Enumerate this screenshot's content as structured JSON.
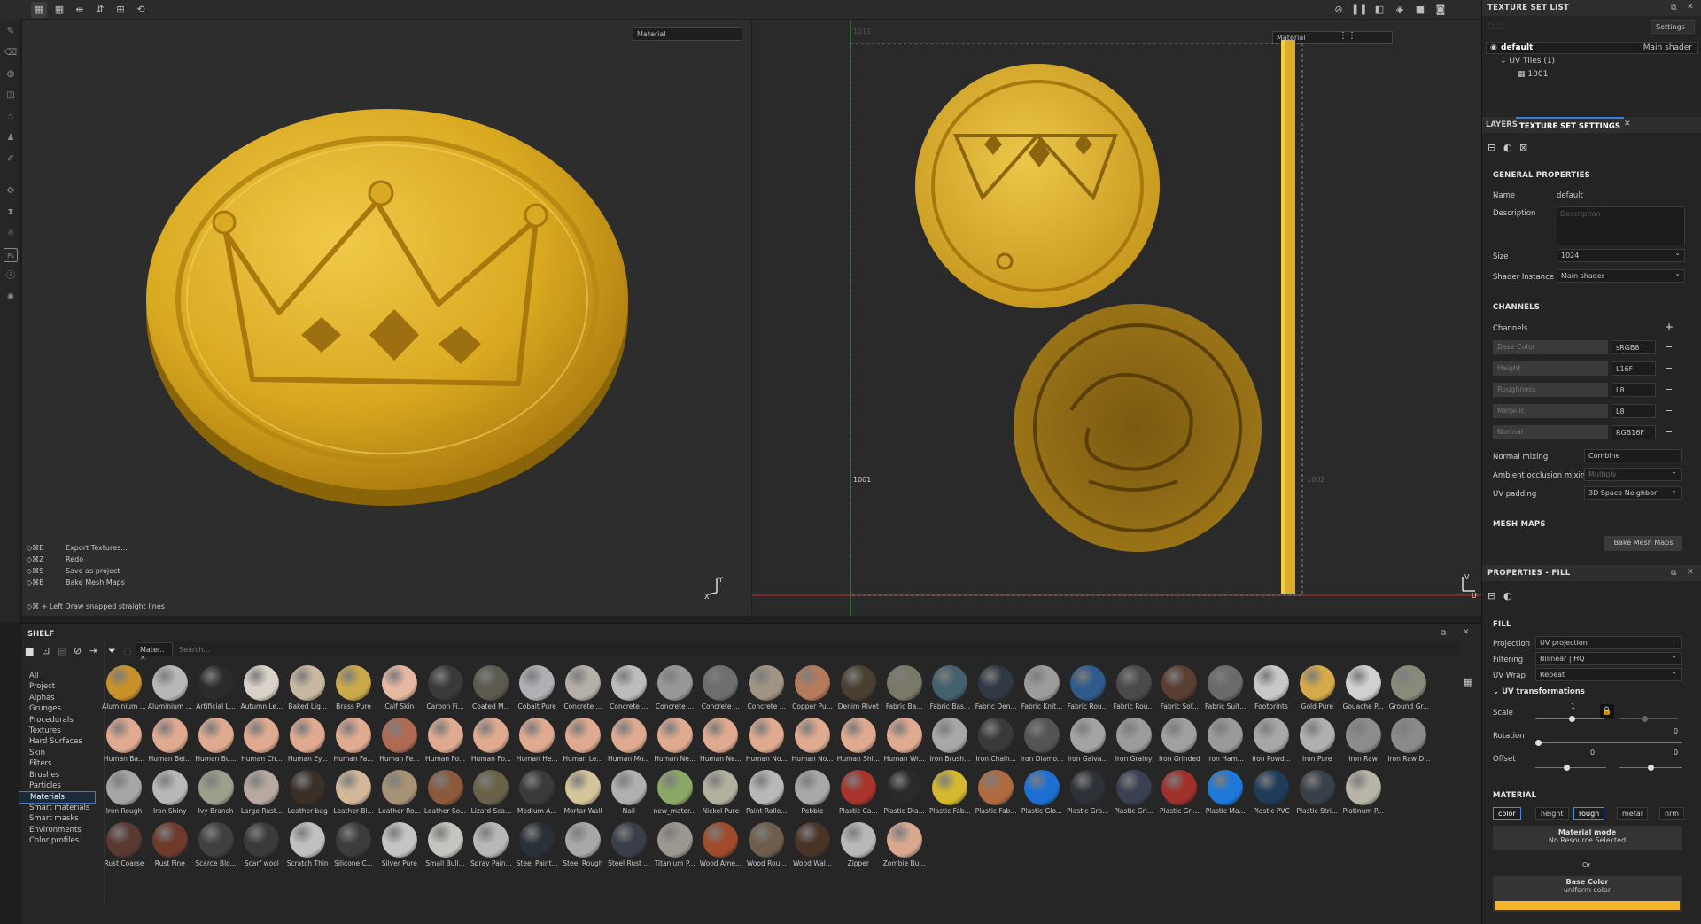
{
  "toolbar": {
    "viewport_left_select": "Material",
    "viewport_right_select": "Material"
  },
  "hotkeys": [
    {
      "keys": "◇⌘E",
      "action": "Export Textures..."
    },
    {
      "keys": "◇⌘Z",
      "action": "Redo"
    },
    {
      "keys": "◇⌘S",
      "action": "Save as project"
    },
    {
      "keys": "◇⌘B",
      "action": "Bake Mesh Maps"
    }
  ],
  "hint": "◇⌘ + Left  Draw snapped straight lines",
  "uv": {
    "tile_label": "1001",
    "next_tile_label": "1002",
    "top_tile_label": "1011"
  },
  "texture_set_list": {
    "title": "TEXTURE SET LIST",
    "settings_button": "Settings",
    "set_name": "default",
    "set_shader": "Main shader",
    "uv_tiles_label": "UV Tiles (1)",
    "tile": "1001"
  },
  "tabs": {
    "layers": "LAYERS",
    "texture_set_settings": "TEXTURE SET SETTINGS"
  },
  "general": {
    "title": "GENERAL PROPERTIES",
    "name_label": "Name",
    "name_value": "default",
    "description_label": "Description",
    "description_placeholder": "Description",
    "size_label": "Size",
    "size_value": "1024",
    "shader_label": "Shader Instance",
    "shader_value": "Main shader"
  },
  "channels": {
    "title": "CHANNELS",
    "channels_label": "Channels",
    "items": [
      {
        "name": "Base Color",
        "format": "sRGB8"
      },
      {
        "name": "Height",
        "format": "L16F"
      },
      {
        "name": "Roughness",
        "format": "L8"
      },
      {
        "name": "Metallic",
        "format": "L8"
      },
      {
        "name": "Normal",
        "format": "RGB16F"
      }
    ],
    "normal_mixing_label": "Normal mixing",
    "normal_mixing_value": "Combine",
    "ao_mixing_label": "Ambient occlusion mixing",
    "ao_mixing_value": "Multiply",
    "uv_padding_label": "UV padding",
    "uv_padding_value": "3D Space Neighbor"
  },
  "mesh_maps": {
    "title": "MESH MAPS",
    "bake_button": "Bake Mesh Maps"
  },
  "properties": {
    "title": "PROPERTIES - FILL",
    "fill_title": "FILL",
    "projection_label": "Projection",
    "projection_value": "UV projection",
    "filtering_label": "Filtering",
    "filtering_value": "Bilinear | HQ",
    "uvwrap_label": "UV Wrap",
    "uvwrap_value": "Repeat",
    "uvtrans_title": "UV transformations",
    "scale_label": "Scale",
    "scale_value": "1",
    "rotation_label": "Rotation",
    "rotation_value": "0",
    "offset_label": "Offset",
    "offset_x": "0",
    "offset_y": "0",
    "material_title": "MATERIAL",
    "mat_tabs": [
      "color",
      "height",
      "rough",
      "metal",
      "nrm"
    ],
    "material_mode_label": "Material mode",
    "material_mode_value": "No Resource Selected",
    "or_label": "Or",
    "base_color_label": "Base Color",
    "base_color_value": "uniform color",
    "base_color_hex": "#f4b62a"
  },
  "shelf": {
    "title": "SHELF",
    "filter_chip": "Mater..",
    "search_placeholder": "Search...",
    "categories": [
      "All",
      "Project",
      "Alphas",
      "Grunges",
      "Procedurals",
      "Textures",
      "Hard Surfaces",
      "Skin",
      "Filters",
      "Brushes",
      "Particles",
      "Materials",
      "Smart materials",
      "Smart masks",
      "Environments",
      "Color profiles"
    ],
    "selected_category": "Materials",
    "materials": [
      {
        "name": "Aluminium ...",
        "color": "#c9912a"
      },
      {
        "name": "Aluminium ...",
        "color": "#b8b8b8"
      },
      {
        "name": "Artificial L...",
        "color": "#2c2c2c"
      },
      {
        "name": "Autumn Le...",
        "color": "#d9d2c8"
      },
      {
        "name": "Baked Lig...",
        "color": "#c8b8a0"
      },
      {
        "name": "Brass Pure",
        "color": "#c9a94a"
      },
      {
        "name": "Calf Skin",
        "color": "#e6b8a2"
      },
      {
        "name": "Carbon Fi...",
        "color": "#3a3a3a"
      },
      {
        "name": "Coated M...",
        "color": "#5c5a4e"
      },
      {
        "name": "Cobalt Pure",
        "color": "#b0b0b4"
      },
      {
        "name": "Concrete ...",
        "color": "#b4b0a8"
      },
      {
        "name": "Concrete ...",
        "color": "#bcbcbc"
      },
      {
        "name": "Concrete ...",
        "color": "#989898"
      },
      {
        "name": "Concrete ...",
        "color": "#6e6e6e"
      },
      {
        "name": "Concrete ...",
        "color": "#a09484"
      },
      {
        "name": "Copper Pu...",
        "color": "#b57a5c"
      },
      {
        "name": "Denim Rivet",
        "color": "#4a4032"
      },
      {
        "name": "Fabric Ba...",
        "color": "#7a7866"
      },
      {
        "name": "Fabric Bas...",
        "color": "#44606e"
      },
      {
        "name": "Fabric Den...",
        "color": "#303844"
      },
      {
        "name": "Fabric Knit...",
        "color": "#9c9c9c"
      },
      {
        "name": "Fabric Rou...",
        "color": "#2e5a8c"
      },
      {
        "name": "Fabric Rou...",
        "color": "#4a4a4a"
      },
      {
        "name": "Fabric Sof...",
        "color": "#5a3e30"
      },
      {
        "name": "Fabric Suit...",
        "color": "#6a6a6a"
      },
      {
        "name": "Footprints",
        "color": "#c8c8c8"
      },
      {
        "name": "Gold Pure",
        "color": "#d4aa4a"
      },
      {
        "name": "Gouache P...",
        "color": "#d0d0d0"
      },
      {
        "name": "Ground Gr...",
        "color": "#8a8a7a"
      },
      {
        "name": "Human Ba...",
        "color": "#e0aa90"
      },
      {
        "name": "Human Bel...",
        "color": "#e0aa90"
      },
      {
        "name": "Human Bu...",
        "color": "#e0aa90"
      },
      {
        "name": "Human Ch...",
        "color": "#e0aa90"
      },
      {
        "name": "Human Ey...",
        "color": "#e0aa90"
      },
      {
        "name": "Human Fa...",
        "color": "#e0aa90"
      },
      {
        "name": "Human Fe...",
        "color": "#b06a54"
      },
      {
        "name": "Human Fo...",
        "color": "#e0aa90"
      },
      {
        "name": "Human Fo...",
        "color": "#e0aa90"
      },
      {
        "name": "Human He...",
        "color": "#e0aa90"
      },
      {
        "name": "Human Le...",
        "color": "#e0aa90"
      },
      {
        "name": "Human Mo...",
        "color": "#e0aa90"
      },
      {
        "name": "Human Ne...",
        "color": "#e0aa90"
      },
      {
        "name": "Human Ne...",
        "color": "#e0aa90"
      },
      {
        "name": "Human No...",
        "color": "#e0aa90"
      },
      {
        "name": "Human No...",
        "color": "#e0aa90"
      },
      {
        "name": "Human Shi...",
        "color": "#e0aa90"
      },
      {
        "name": "Human Wr...",
        "color": "#e0aa90"
      },
      {
        "name": "Iron Brush...",
        "color": "#a8a8a8"
      },
      {
        "name": "Iron Chain...",
        "color": "#3a3a3a"
      },
      {
        "name": "Iron Diamo...",
        "color": "#545454"
      },
      {
        "name": "Iron Galva...",
        "color": "#a4a4a4"
      },
      {
        "name": "Iron Grainy",
        "color": "#9c9c9c"
      },
      {
        "name": "Iron Grinded",
        "color": "#a0a0a0"
      },
      {
        "name": "Iron Ham...",
        "color": "#9a9a9a"
      },
      {
        "name": "Iron Powd...",
        "color": "#a8a8a8"
      },
      {
        "name": "Iron Pure",
        "color": "#b0b0b0"
      },
      {
        "name": "Iron Raw",
        "color": "#8c8c8c"
      },
      {
        "name": "Iron Raw D...",
        "color": "#8a8a8a"
      },
      {
        "name": "Iron Rough",
        "color": "#a6a6a6"
      },
      {
        "name": "Iron Shiny",
        "color": "#b8b8b8"
      },
      {
        "name": "Ivy Branch",
        "color": "#9aa08a"
      },
      {
        "name": "Large Rust...",
        "color": "#b8a8a0"
      },
      {
        "name": "Leather bag",
        "color": "#3a3028"
      },
      {
        "name": "Leather Bl...",
        "color": "#d2b898"
      },
      {
        "name": "Leather Ro...",
        "color": "#a89276"
      },
      {
        "name": "Leather So...",
        "color": "#8a5a3a"
      },
      {
        "name": "Lizard Sca...",
        "color": "#6a6248"
      },
      {
        "name": "Medium A...",
        "color": "#3a3a3a"
      },
      {
        "name": "Mortar Wall",
        "color": "#d4c49a"
      },
      {
        "name": "Nail",
        "color": "#b0b0b0"
      },
      {
        "name": "new_mater...",
        "color": "#8ca868"
      },
      {
        "name": "Nickel Pure",
        "color": "#b4b0a0"
      },
      {
        "name": "Paint Rolle...",
        "color": "#b8b8b8"
      },
      {
        "name": "Pebble",
        "color": "#a8a8a8"
      },
      {
        "name": "Plastic Ca...",
        "color": "#a8342c"
      },
      {
        "name": "Plastic Dia...",
        "color": "#2a2a2a"
      },
      {
        "name": "Plastic Fab...",
        "color": "#d4b830"
      },
      {
        "name": "Plastic Fab...",
        "color": "#b06a40"
      },
      {
        "name": "Plastic Glo...",
        "color": "#1c70d4"
      },
      {
        "name": "Plastic Gra...",
        "color": "#2e3238"
      },
      {
        "name": "Plastic Gri...",
        "color": "#384052"
      },
      {
        "name": "Plastic Gri...",
        "color": "#a0302c"
      },
      {
        "name": "Plastic Ma...",
        "color": "#1e78d8"
      },
      {
        "name": "Plastic PVC",
        "color": "#1e3c58"
      },
      {
        "name": "Plastic Stri...",
        "color": "#384048"
      },
      {
        "name": "Platinum P...",
        "color": "#b8b4a8"
      },
      {
        "name": "Rust Coarse",
        "color": "#5a3a30"
      },
      {
        "name": "Rust Fine",
        "color": "#6e3a2c"
      },
      {
        "name": "Scarce Blo...",
        "color": "#404040"
      },
      {
        "name": "Scarf wool",
        "color": "#3a3a3a"
      },
      {
        "name": "Scratch Thin",
        "color": "#c0c0c0"
      },
      {
        "name": "Silicone C...",
        "color": "#3c3c3c"
      },
      {
        "name": "Silver Pure",
        "color": "#c4c4c4"
      },
      {
        "name": "Small Bull...",
        "color": "#c4c4c0"
      },
      {
        "name": "Spray Pain...",
        "color": "#b8b8b8"
      },
      {
        "name": "Steel Paint...",
        "color": "#2a3038"
      },
      {
        "name": "Steel Rough",
        "color": "#a8a8a8"
      },
      {
        "name": "Steel Rust ...",
        "color": "#3a3e48"
      },
      {
        "name": "Titanium P...",
        "color": "#9c9890"
      },
      {
        "name": "Wood Ame...",
        "color": "#a04c2c"
      },
      {
        "name": "Wood Rou...",
        "color": "#6e5e4c"
      },
      {
        "name": "Wood Wal...",
        "color": "#4a3428"
      },
      {
        "name": "Zipper",
        "color": "#b8b8b8"
      },
      {
        "name": "Zombie Bu...",
        "color": "#d8a890"
      }
    ]
  }
}
